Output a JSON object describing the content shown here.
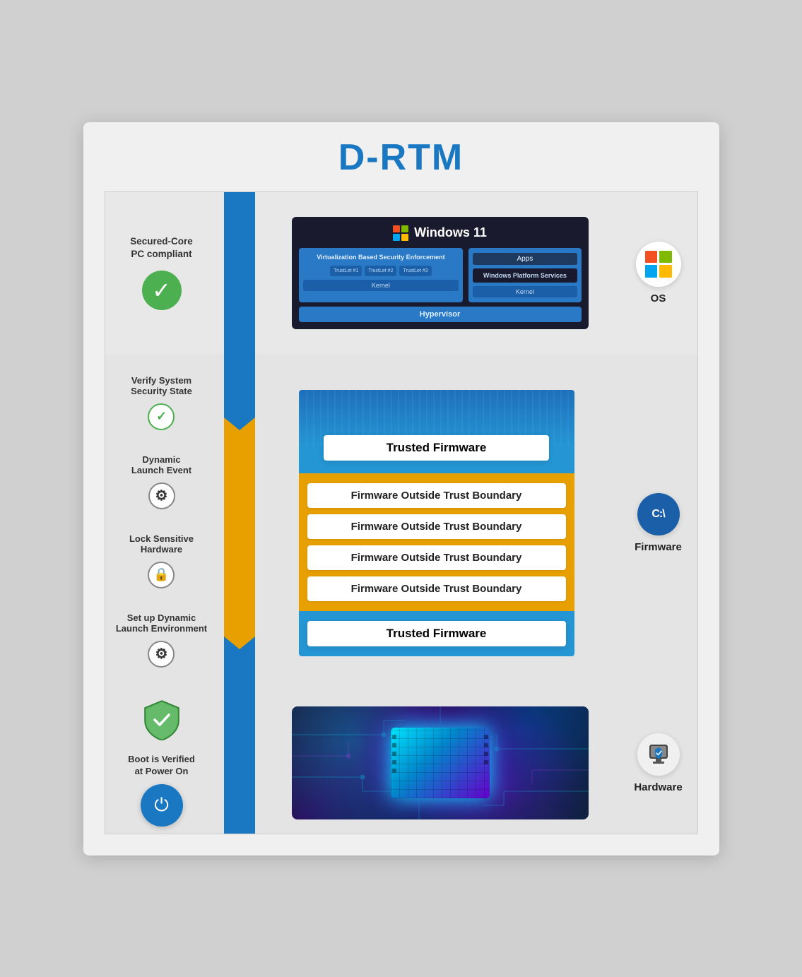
{
  "title": "D-RTM",
  "sections": {
    "os": {
      "left_label": "Secured-Core\nPC compliant",
      "right_label": "OS",
      "win11_title": "Windows 11",
      "win11_windows_logo": "⊞",
      "vbs_title": "Virtualization Based\nSecurity Enforcement",
      "trustlet1": "TrustLet #1",
      "trustlet2": "TrustLet #2",
      "trustlet3": "TrustLet #3",
      "kernel_vbs": "Kernel",
      "apps": "Apps",
      "wps_title": "Windows\nPlatform\nServices",
      "kernel_right": "Kernel",
      "hypervisor": "Hypervisor"
    },
    "firmware": {
      "label_verify": "Verify System\nSecurity State",
      "label_dynamic": "Dynamic\nLaunch Event",
      "label_lock": "Lock Sensitive\nHardware",
      "label_setup": "Set up Dynamic\nLaunch Environment",
      "trusted_fw_top": "Trusted Firmware",
      "outside_bands": [
        "Firmware Outside Trust Boundary",
        "Firmware Outside Trust Boundary",
        "Firmware Outside Trust Boundary",
        "Firmware Outside Trust Boundary"
      ],
      "trusted_fw_bottom": "Trusted Firmware",
      "right_label": "Firmware"
    },
    "hardware": {
      "left_label": "Boot is Verified\nat Power On",
      "right_label": "Hardware"
    }
  },
  "icons": {
    "check": "✓",
    "gear": "⚙",
    "lock": "🔒",
    "power": "⏻",
    "shield_check": "🛡",
    "windows_squares": [
      "#f25022",
      "#7fba00",
      "#00a4ef",
      "#ffb900"
    ],
    "cmd_text": "C:\\",
    "hardware_icon": "🖥"
  }
}
